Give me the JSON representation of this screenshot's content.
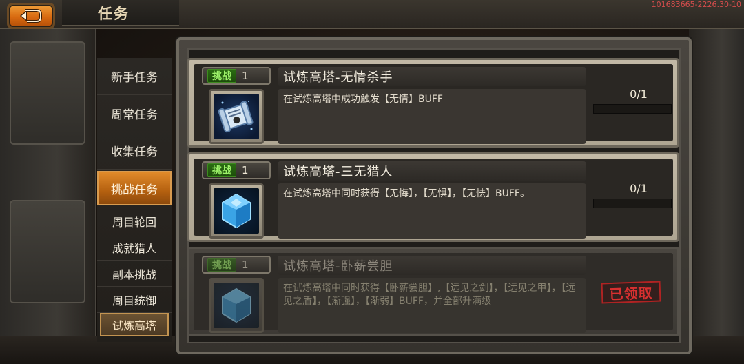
{
  "header": {
    "title": "任务",
    "server_code": "101683665-2226.30-10"
  },
  "sidebar": {
    "tabs": [
      {
        "label": "新手任务"
      },
      {
        "label": "周常任务"
      },
      {
        "label": "收集任务"
      },
      {
        "label": "挑战任务",
        "state": "active"
      }
    ],
    "subtabs": [
      {
        "label": "周目轮回"
      },
      {
        "label": "成就猎人"
      },
      {
        "label": "副本挑战"
      },
      {
        "label": "周目统御"
      },
      {
        "label": "试炼高塔",
        "state": "active"
      }
    ]
  },
  "tasks": [
    {
      "badge_tag": "挑战",
      "badge_num": "1",
      "title": "试炼高塔-无情杀手",
      "icon": "scroll-icon",
      "description": "在试炼高塔中成功触发【无情】BUFF",
      "progress_text": "0/1",
      "progress": 0,
      "status": "in-progress"
    },
    {
      "badge_tag": "挑战",
      "badge_num": "1",
      "title": "试炼高塔-三无猎人",
      "icon": "blue-gem-icon",
      "description": "在试炼高塔中同时获得【无悔】，【无惧】，【无怯】BUFF。",
      "progress_text": "0/1",
      "progress": 0,
      "status": "in-progress"
    },
    {
      "badge_tag": "挑战",
      "badge_num": "1",
      "title": "试炼高塔-卧薪尝胆",
      "icon": "blue-gem-icon",
      "description": "在试炼高塔中同时获得【卧薪尝胆】,【远见之剑】，【远见之甲】，【远见之盾】，【渐强】，【渐弱】BUFF，并全部升满级",
      "stamp": "已领取",
      "status": "claimed"
    }
  ],
  "colors": {
    "accent_orange": "#d86a10",
    "badge_green": "#9ef36a",
    "stamp_red": "#d83030",
    "server_code_red": "#d44c4c"
  }
}
